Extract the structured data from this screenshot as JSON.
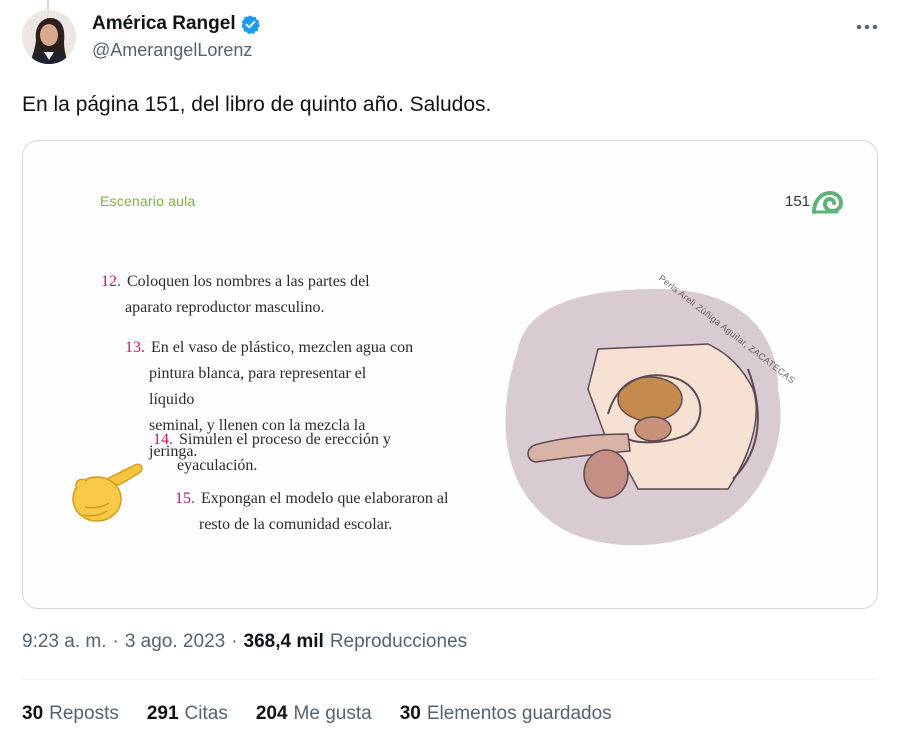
{
  "author": {
    "display_name": "América Rangel",
    "handle": "@AmerangelLorenz",
    "verified": true,
    "verified_color": "#1d9bf0"
  },
  "tweet": {
    "text": "En la página 151, del libro de quinto año. Saludos."
  },
  "media": {
    "section": "Escenario aula",
    "page_number": "151",
    "credit": "Perla Areli Zúñiga Aguilar, ZACATECAS",
    "instructions": [
      {
        "num": "12.",
        "line1": "Coloquen los nombres a las partes del",
        "line2": "aparato reproductor masculino."
      },
      {
        "num": "13.",
        "line1": "En el vaso de plástico, mezclen agua con",
        "line2": "pintura blanca, para representar el líquido",
        "line3": "seminal, y llenen con la mezcla la jeringa."
      },
      {
        "num": "14.",
        "line1": "Simulen el proceso de erección y",
        "line2": "eyaculación."
      },
      {
        "num": "15.",
        "line1": "Expongan el modelo que elaboraron al",
        "line2": "resto de la comunidad escolar."
      }
    ],
    "hand_emoji": "👉"
  },
  "meta": {
    "time": "9:23 a. m.",
    "sep1": "·",
    "date": "3 ago. 2023",
    "sep2": "·",
    "views_count": "368,4 mil",
    "views_label": "Reproducciones"
  },
  "stats": {
    "reposts_count": "30",
    "reposts_label": "Reposts",
    "quotes_count": "291",
    "quotes_label": "Citas",
    "likes_count": "204",
    "likes_label": "Me gusta",
    "bookmarks_count": "30",
    "bookmarks_label": "Elementos guardados"
  }
}
